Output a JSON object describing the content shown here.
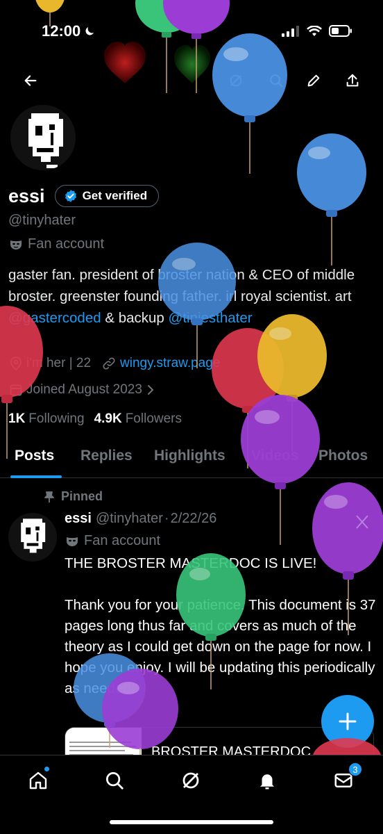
{
  "status": {
    "time": "12:00"
  },
  "profile": {
    "display_name": "essi",
    "verify_label": "Get verified",
    "handle": "@tinyhater",
    "category": "Fan account",
    "bio_parts": [
      "gaster fan. president of broster nation & CEO of middle broster. greenster founding father. irl royal scientist. art ",
      "@gastercoded",
      " & backup ",
      "@tiniesthater"
    ],
    "pronouns": "i'm her | 22",
    "website": "wingy.straw.page",
    "joined": "Joined August 2023",
    "following_count": "1K",
    "following_label": "Following",
    "followers_count": "4.9K",
    "followers_label": "Followers"
  },
  "tabs": [
    "Posts",
    "Replies",
    "Highlights",
    "Videos",
    "Photos"
  ],
  "post": {
    "pinned_label": "Pinned",
    "author": "essi",
    "handle": "@tinyhater",
    "separator": "·",
    "date": "2/22/26",
    "category": "Fan account",
    "text": "THE BROSTER MASTERDOC IS LIVE!\n\nThank you for your patience. This document is 37 pages long thus far and covers as much of the theory as I could get down on the page for now. I hope you enjoy. I will be updating this periodically as needed.",
    "card_title": "BROSTER MASTERDOC"
  },
  "bottom_nav": {
    "messages_badge": "3"
  },
  "colors": {
    "accent": "#1d9bf0",
    "muted": "#71767b",
    "text": "#e7e9ea"
  },
  "icons": [
    "back-arrow-icon",
    "grok-icon",
    "search-icon",
    "edit-icon",
    "share-icon",
    "mask-icon",
    "location-icon",
    "link-icon",
    "calendar-icon",
    "pin-icon",
    "home-icon",
    "search-icon",
    "grok-icon",
    "bell-icon",
    "mail-icon",
    "plus-icon"
  ]
}
